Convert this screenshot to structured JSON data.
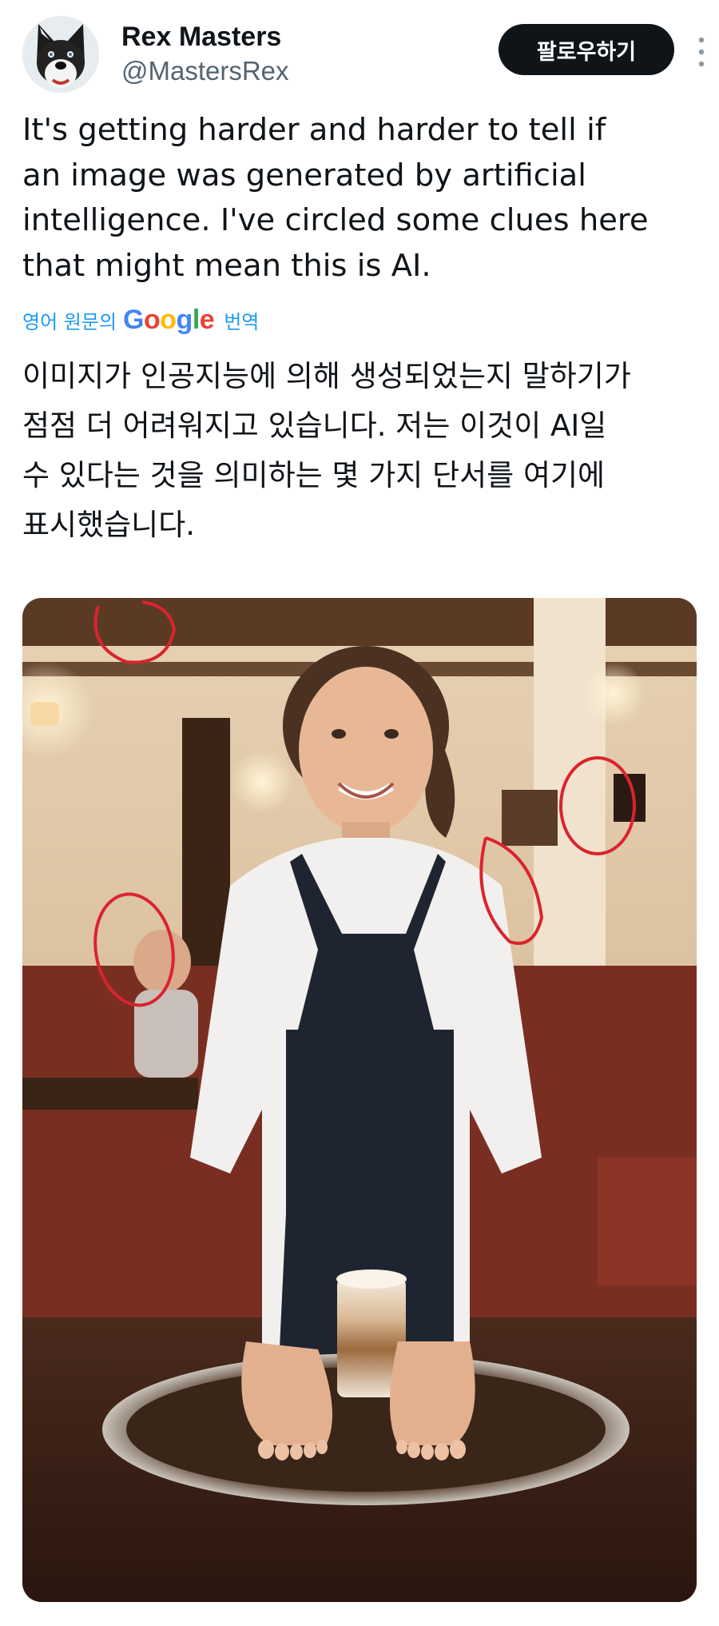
{
  "author": {
    "display_name": "Rex Masters",
    "handle": "@MastersRex",
    "avatar_icon": "husky-avatar"
  },
  "actions": {
    "follow_label": "팔로우하기",
    "more_icon": "more-vertical-icon"
  },
  "tweet": {
    "lines": [
      "It's getting harder and harder to tell if",
      "an image was generated by artificial",
      "intelligence. I've circled some clues here",
      "that might mean this is AI."
    ]
  },
  "translation": {
    "prefix": "영어 원문의",
    "brand": "Google",
    "suffix": "번역",
    "lines": [
      "이미지가 인공지능에 의해 생성되었는지 말하기가",
      "점점 더 어려워지고 있습니다. 저는 이것이 AI일",
      "수 있다는 것을 의미하는 몇 가지 단서를 여기에",
      "표시했습니다."
    ]
  },
  "media": {
    "type": "photo",
    "subject": "waitress-with-tray-and-latte",
    "annotation_color": "#d9242f"
  },
  "colors": {
    "link": "#1d9bf0",
    "text": "#0f1419",
    "secondary": "#536471",
    "button_bg": "#0f1419"
  }
}
